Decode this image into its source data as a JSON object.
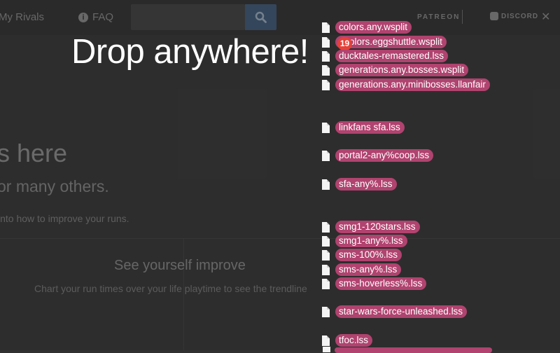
{
  "nav": {
    "rivals_label": "My Rivals",
    "faq_label": "FAQ",
    "faq_icon": "info-icon",
    "search_placeholder": "",
    "patreon_label": "PATREON",
    "discord_label": "DISCORD",
    "close_glyph": "✕"
  },
  "background": {
    "hero_title_partial": "s here",
    "hero_sub_partial": "or many others.",
    "hero_desc_partial": "into how to improve your runs.",
    "feature_title": "See yourself improve",
    "feature_desc": "Chart your run times over your life playtime to see the trendline"
  },
  "overlay": {
    "drop_title": "Drop anywhere!",
    "badge_count": "19"
  },
  "files": [
    {
      "name": "colors.any.wsplit"
    },
    {
      "name": "olors.eggshuttle.wsplit"
    },
    {
      "name": "ducktales-remastered.lss"
    },
    {
      "name": "generations.any.bosses.wsplit"
    },
    {
      "name": "generations.any.minibosses.llanfair"
    },
    {
      "name": "linkfans sfa.lss"
    },
    {
      "name": "portal2-any%coop.lss"
    },
    {
      "name": "sfa-any%.lss"
    },
    {
      "name": "smg1-120stars.lss"
    },
    {
      "name": "smg1-any%.lss"
    },
    {
      "name": "sms-100%.lss"
    },
    {
      "name": "sms-any%.lss"
    },
    {
      "name": "sms-hoverless%.lss"
    },
    {
      "name": "star-wars-force-unleashed.lss"
    },
    {
      "name": "tfoc.lss"
    }
  ],
  "colors": {
    "file_label_bg": "#b0436f",
    "badge_bg": "#e5413a",
    "search_button_bg": "#3b5777"
  }
}
